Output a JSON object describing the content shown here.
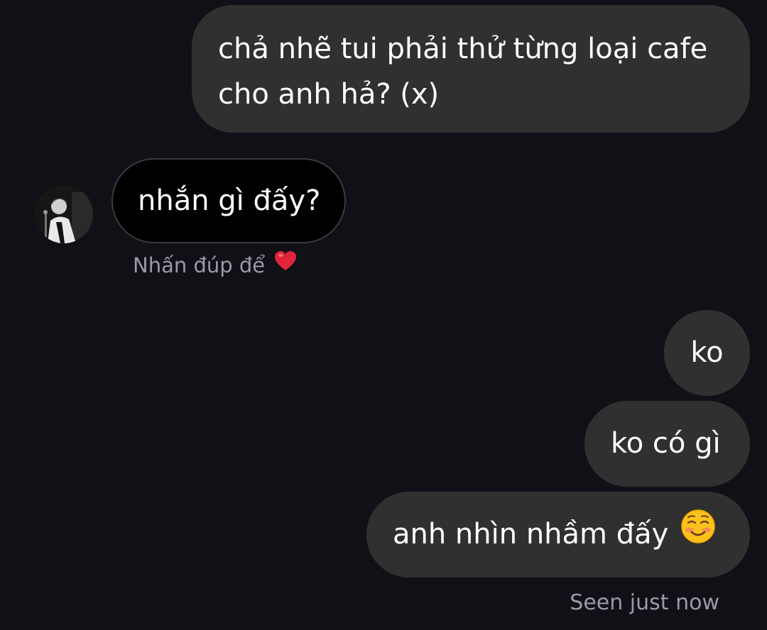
{
  "conversation": {
    "messages": [
      {
        "sender": "me",
        "text": "chả nhẽ tui phải thử từng loại cafe cho anh hả? (x)"
      },
      {
        "sender": "them",
        "text": "nhắn gì đấy?"
      },
      {
        "sender": "me",
        "text": "ko"
      },
      {
        "sender": "me",
        "text": "ko có gì"
      },
      {
        "sender": "me",
        "text": "anh nhìn nhầm đấy",
        "emoji_icon": "smiling-blush-emoji"
      }
    ],
    "reaction_hint": {
      "text": "Nhấn đúp để",
      "icon": "heart-icon",
      "icon_color": "#e0243a"
    },
    "seen_status": "Seen just now"
  },
  "colors": {
    "background": "#101017",
    "sent_bubble": "#303030",
    "received_bubble": "#000000",
    "secondary_text": "#9a9aa6"
  }
}
